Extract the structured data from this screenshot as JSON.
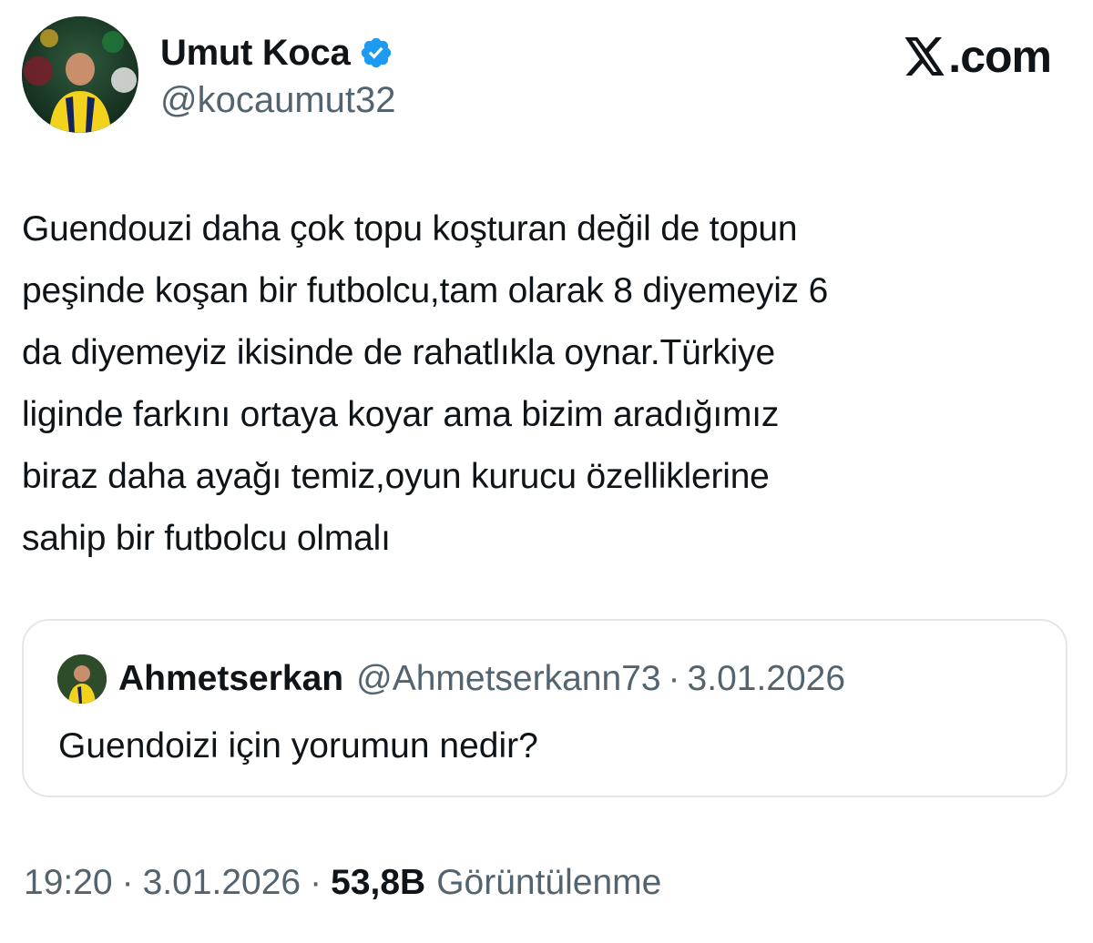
{
  "colors": {
    "text_primary": "#0f1419",
    "text_secondary": "#536471",
    "verified_blue": "#1d9bf0",
    "card_border": "#e2e7ea"
  },
  "author": {
    "name": "Umut Koca",
    "handle": "@kocaumut32",
    "verified": true,
    "avatar_icon": "profile-photo-avatar",
    "avatar_caption": "Umut Koca"
  },
  "brand": {
    "logo_icon": "x-logo-icon",
    "text": ".com"
  },
  "tweet": {
    "text": "Guendouzi daha çok topu koşturan değil de topun\npeşinde koşan bir futbolcu,tam olarak 8 diyemeyiz 6\nda diyemeyiz ikisinde de rahatlıkla oynar.Türkiye\nliginde farkını ortaya koyar ama bizim aradığımız\nbiraz daha ayağı temiz,oyun kurucu özelliklerine\nsahip bir futbolcu olmalı"
  },
  "quote": {
    "author_name": "Ahmetserkan",
    "handle": "@Ahmetserkann73",
    "separator": "·",
    "date": "3.01.2026",
    "text": "Guendoizi için yorumun nedir?",
    "avatar_icon": "profile-photo-avatar"
  },
  "meta": {
    "time": "19:20",
    "separator": "·",
    "date": "3.01.2026",
    "views_count": "53,8B",
    "views_label": "Görüntülenme"
  }
}
